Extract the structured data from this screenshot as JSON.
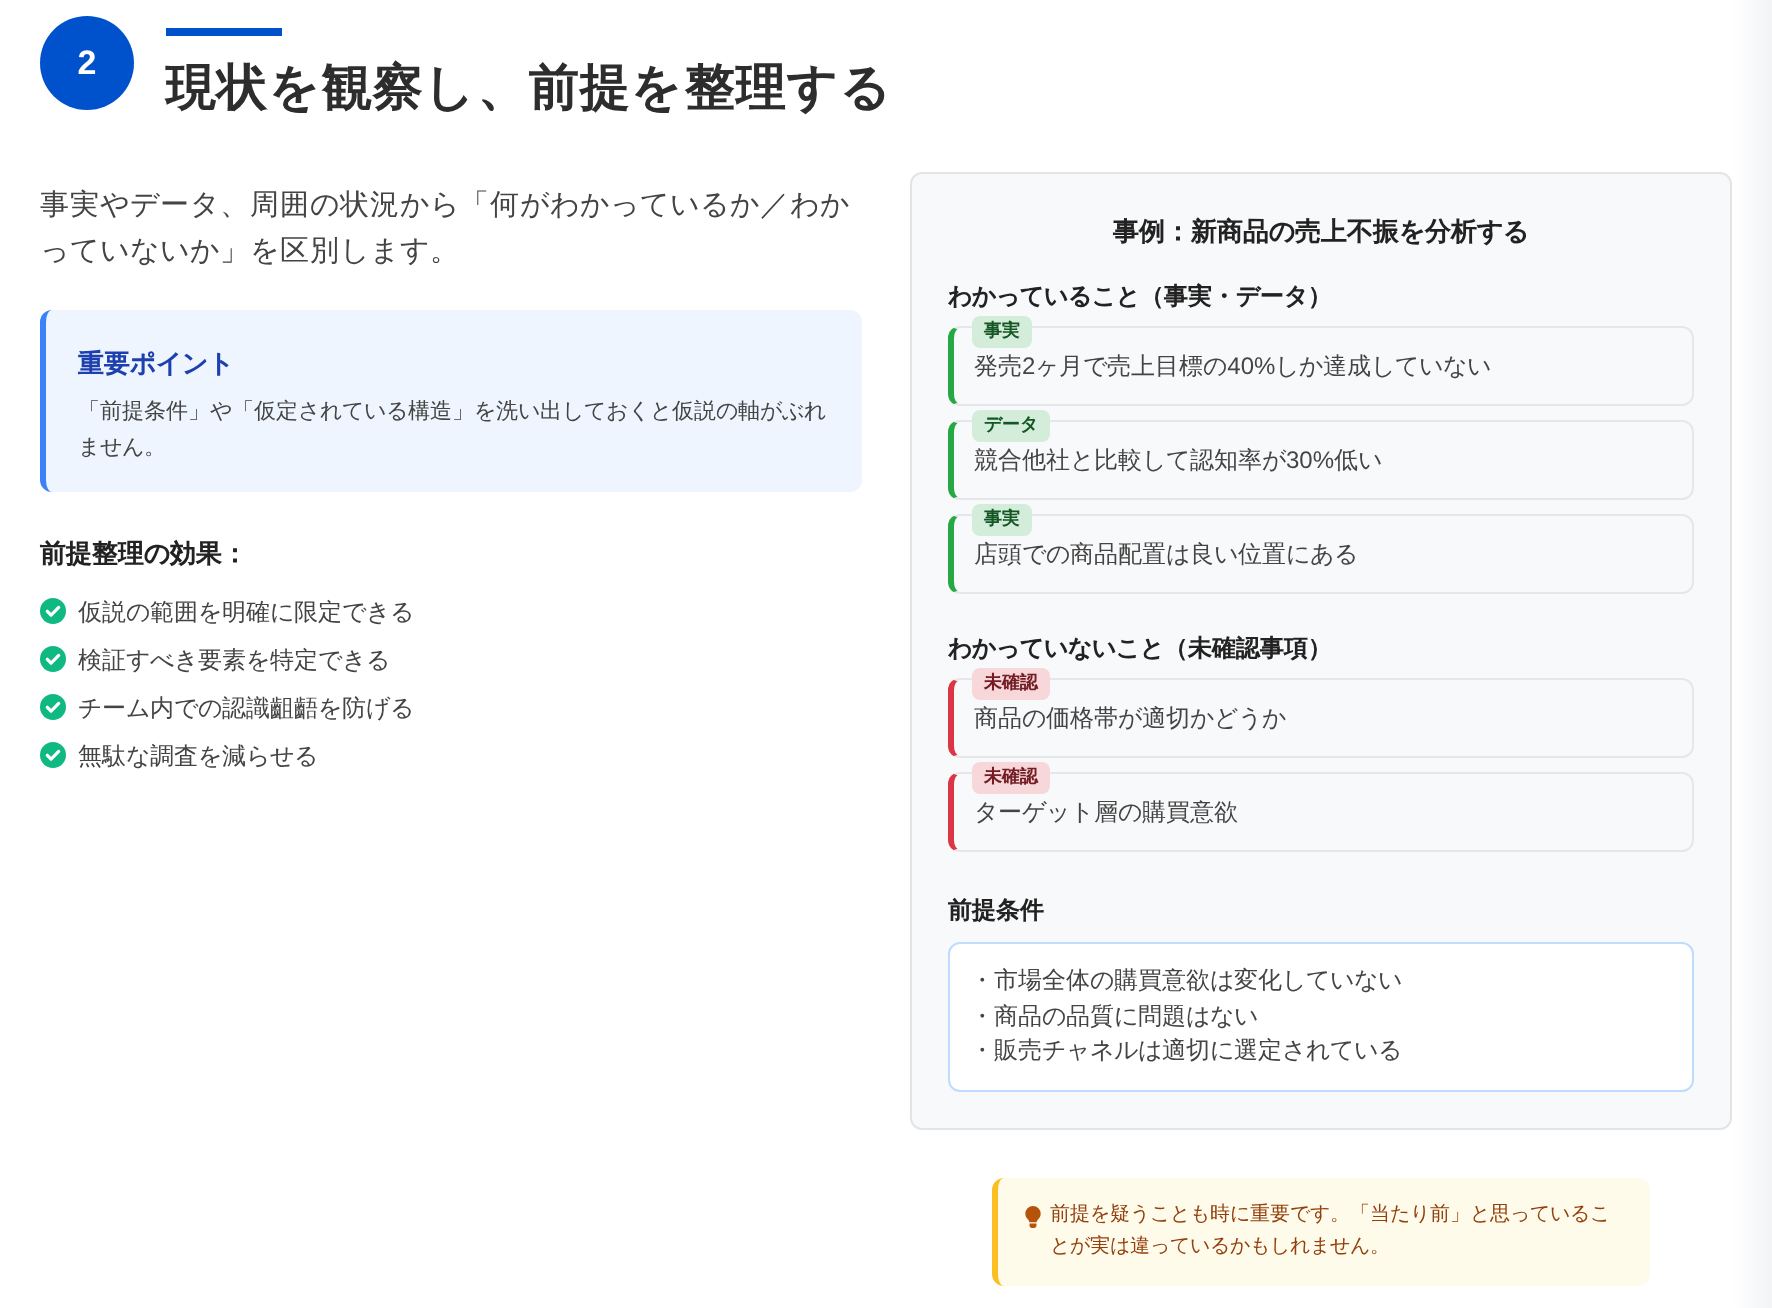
{
  "step": {
    "number": "2",
    "title": "現状を観察し、前提を整理する"
  },
  "intro": "事実やデータ、周囲の状況から「何がわかっているか／わかっていないか」を区別します。",
  "point": {
    "title": "重要ポイント",
    "text": "「前提条件」や「仮定されている構造」を洗い出しておくと仮説の軸がぶれません。"
  },
  "effects": {
    "title": "前提整理の効果：",
    "items": [
      "仮説の範囲を明確に限定できる",
      "検証すべき要素を特定できる",
      "チーム内での認識齟齬を防げる",
      "無駄な調査を減らせる"
    ]
  },
  "example": {
    "title": "事例：新商品の売上不振を分析する",
    "sections": [
      {
        "heading": "わかっていること（事実・データ）",
        "kind": "known",
        "items": [
          {
            "tag": "事実",
            "text": "発売2ヶ月で売上目標の40%しか達成していない"
          },
          {
            "tag": "データ",
            "text": "競合他社と比較して認知率が30%低い"
          },
          {
            "tag": "事実",
            "text": "店頭での商品配置は良い位置にある"
          }
        ]
      },
      {
        "heading": "わかっていないこと（未確認事項）",
        "kind": "unknown",
        "items": [
          {
            "tag": "未確認",
            "text": "商品の価格帯が適切かどうか"
          },
          {
            "tag": "未確認",
            "text": "ターゲット層の購買意欲"
          }
        ]
      }
    ],
    "premises": {
      "heading": "前提条件",
      "items": [
        "・市場全体の購買意欲は変化していない",
        "・商品の品質に問題はない",
        "・販売チャネルは適切に選定されている"
      ]
    }
  },
  "tip": "前提を疑うことも時に重要です。「当たり前」と思っていることが実は違っているかもしれません。"
}
